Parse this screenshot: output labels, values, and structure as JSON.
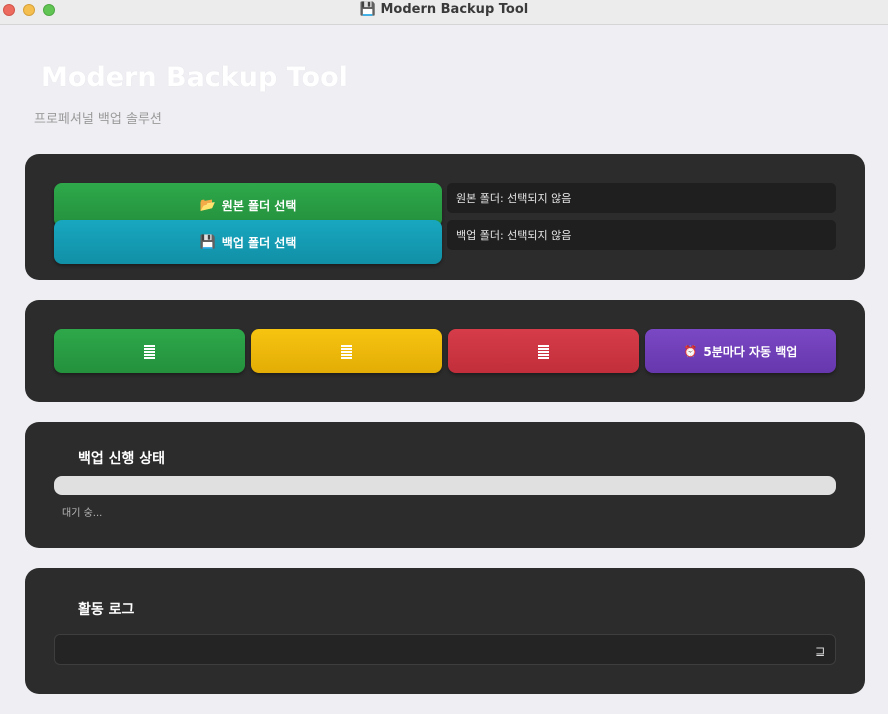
{
  "window": {
    "title_icon": "💾",
    "title": "Modern Backup Tool"
  },
  "header": {
    "title": "Modern Backup Tool",
    "subtitle": "프로페셔널 백업 솔루션"
  },
  "folders": {
    "source_button": {
      "icon": "📂",
      "label": "원본 폴더 선택"
    },
    "backup_button": {
      "icon": "💾",
      "label": "백업 폴더 선택"
    },
    "source_path": "원본 폴더: 선택되지 않음",
    "backup_path": "백업 폴더: 선택되지 않음"
  },
  "actions": {
    "button1_icon": "document-lines-icon",
    "button2_icon": "document-lines-icon",
    "button3_icon": "document-lines-icon",
    "auto_backup": {
      "icon": "⏰",
      "label": "5분마다 자동 백업"
    }
  },
  "progress": {
    "title": "백업 신행 상태",
    "value": 0,
    "status": "대기 숭..."
  },
  "log": {
    "title": "활동 로그",
    "grip_glyph": "⊒"
  },
  "colors": {
    "card_bg": "#2c2c2c",
    "green": "#2ea84a",
    "teal": "#18a7c0",
    "yellow": "#f7c411",
    "red": "#d63c49",
    "purple": "#7a48c4"
  }
}
